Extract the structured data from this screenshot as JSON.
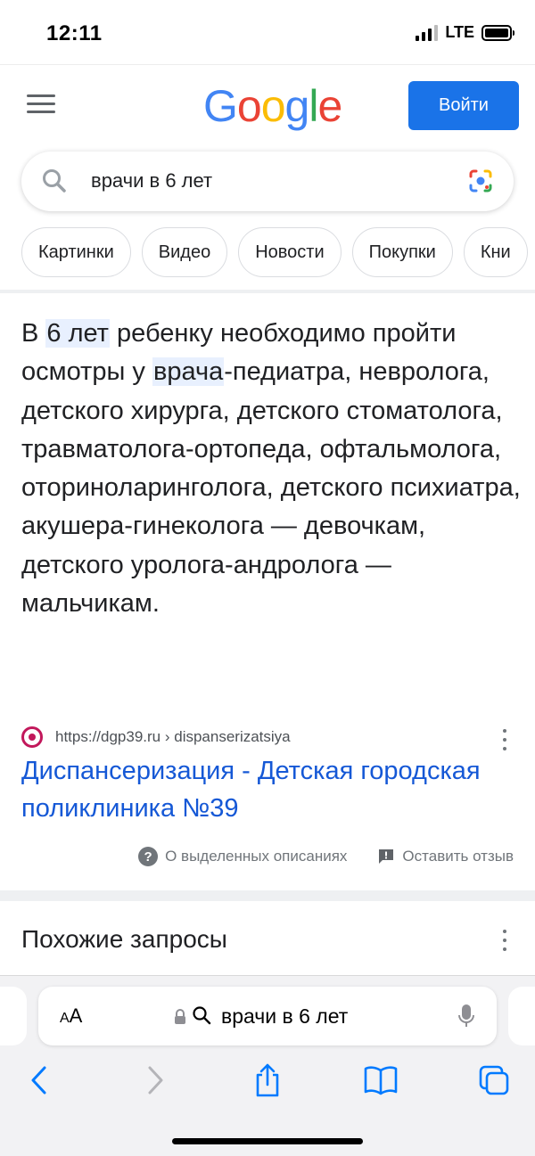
{
  "status_bar": {
    "time": "12:11",
    "network": "LTE"
  },
  "header": {
    "logo_letters": [
      "G",
      "o",
      "o",
      "g",
      "l",
      "e"
    ],
    "signin_label": "Войти"
  },
  "search": {
    "query": "врачи в 6 лет"
  },
  "chips": [
    "Картинки",
    "Видео",
    "Новости",
    "Покупки",
    "Кни"
  ],
  "answer": {
    "part1": "В ",
    "hl1": "6 лет",
    "part2": " ребенку необходимо пройти осмотры у ",
    "hl2": "врача",
    "part3": "-педиатра, невролога, детского хирурга, детского стоматолога, травматолога-ортопеда, офтальмолога, оториноларинголога, детского психиатра, акушера-гинеколога — девочкам, детского уролога-андролога — мальчикам."
  },
  "source": {
    "url": "https://dgp39.ru › dispanserizatsiya",
    "title": "Диспансеризация - Детская городская поликлиника №39"
  },
  "feedback": {
    "about_label": "О выделенных описаниях",
    "feedback_label": "Оставить отзыв"
  },
  "related": {
    "title": "Похожие запросы"
  },
  "safari": {
    "aa_small": "A",
    "aa_large": "A",
    "address": "врачи в 6 лет"
  },
  "colors": {
    "google_blue": "#4285f4",
    "google_red": "#ea4335",
    "google_yellow": "#fbbc05",
    "google_green": "#34a853",
    "button_blue": "#1a73e8",
    "link_blue": "#1558d6",
    "highlight": "#e8f0fe",
    "safari_blue": "#007aff"
  }
}
